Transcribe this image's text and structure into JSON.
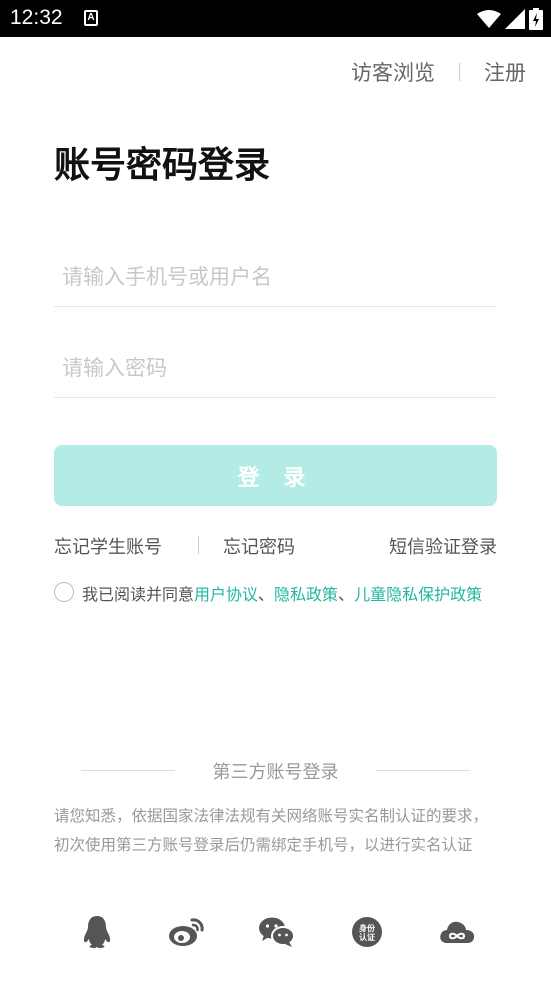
{
  "status_bar": {
    "time": "12:32",
    "notif_icon": "A"
  },
  "top_links": {
    "guest": "访客浏览",
    "register": "注册"
  },
  "title": "账号密码登录",
  "form": {
    "account_placeholder": "请输入手机号或用户名",
    "account_value": "",
    "password_placeholder": "请输入密码",
    "password_value": "",
    "login_label": "登 录"
  },
  "links": {
    "forgot_student": "忘记学生账号",
    "forgot_password": "忘记密码",
    "sms_login": "短信验证登录"
  },
  "agreement": {
    "prefix": "我已阅读并同意",
    "user_agreement": "用户协议",
    "sep1": "、",
    "privacy_policy": "隐私政策",
    "sep2": "、",
    "child_policy": "儿童隐私保护政策",
    "checked": false
  },
  "third_party": {
    "title": "第三方账号登录",
    "notice": "请您知悉，依据国家法律法规有关网络账号实名制认证的要求，初次使用第三方账号登录后仍需绑定手机号，以进行实名认证",
    "id_badge": "身份认证",
    "providers": [
      "qq-icon",
      "weibo-icon",
      "wechat-icon",
      "id-auth-icon",
      "cloud-icon"
    ]
  },
  "colors": {
    "accent": "#22b7a3",
    "button_disabled": "#b3ece4",
    "icon_gray": "#555555"
  }
}
